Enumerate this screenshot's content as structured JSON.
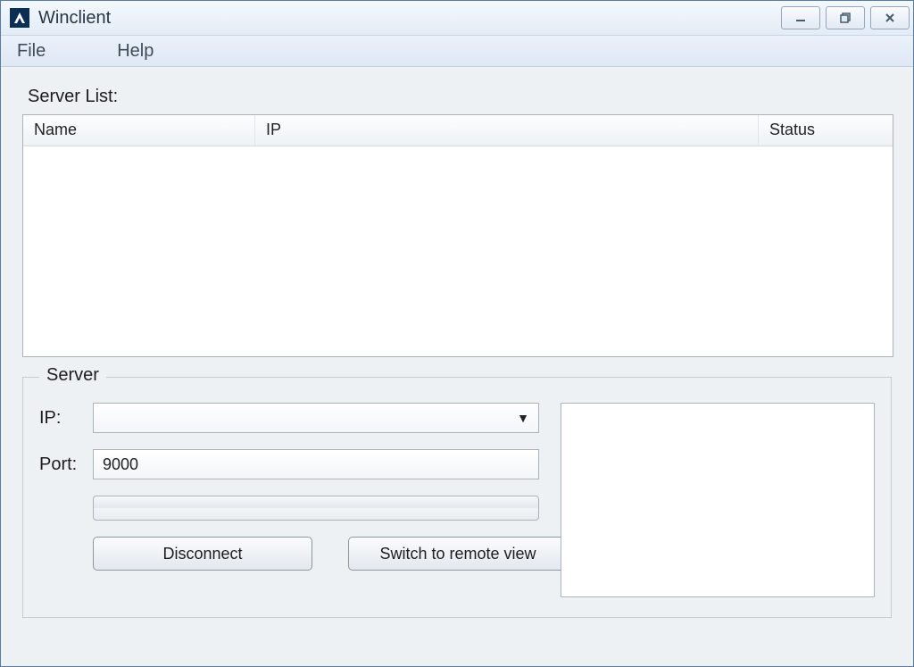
{
  "window": {
    "title": "Winclient",
    "buttons": {
      "minimize": "minimize-icon",
      "restore": "restore-icon",
      "close": "close-icon"
    }
  },
  "menu": {
    "file": "File",
    "help": "Help"
  },
  "serverList": {
    "label": "Server List:",
    "columns": {
      "name": "Name",
      "ip": "IP",
      "status": "Status"
    },
    "rows": []
  },
  "serverGroup": {
    "legend": "Server",
    "ip": {
      "label": "IP:",
      "value": ""
    },
    "port": {
      "label": "Port:",
      "value": "9000"
    },
    "buttons": {
      "disconnect": "Disconnect",
      "switchRemote": "Switch to remote view"
    }
  }
}
